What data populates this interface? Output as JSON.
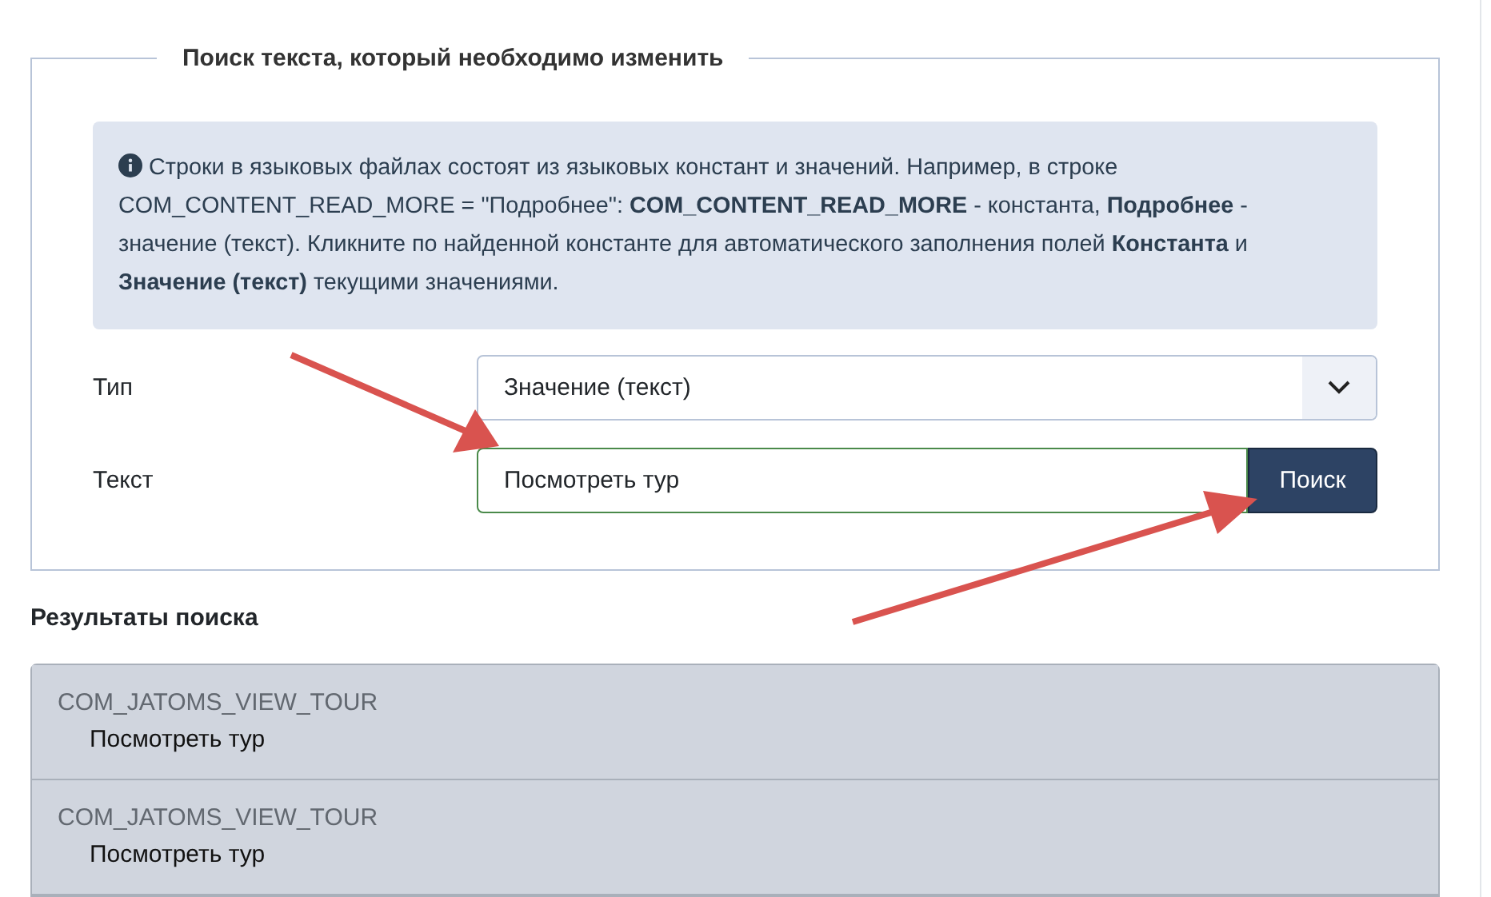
{
  "search_panel": {
    "legend": "Поиск текста, который необходимо изменить",
    "info": "Строки в языковых файлах состоят из языковых констант и значений. Например, в строке COM_CONTENT_READ_MORE = \"Подробнее\": **COM_CONTENT_READ_MORE** - константа, **Подробнее** - значение (текст). Кликните по найденной константе для автоматического заполнения полей **Константа** и **Значение (текст)** текущими значениями.",
    "type_label": "Тип",
    "type_value": "Значение (текст)",
    "text_label": "Текст",
    "text_value": "Посмотреть тур",
    "search_button": "Поиск"
  },
  "results": {
    "heading": "Результаты поиска",
    "items": [
      {
        "constant": "COM_JATOMS_VIEW_TOUR",
        "value": "Посмотреть тур"
      },
      {
        "constant": "COM_JATOMS_VIEW_TOUR",
        "value": "Посмотреть тур"
      }
    ]
  }
}
